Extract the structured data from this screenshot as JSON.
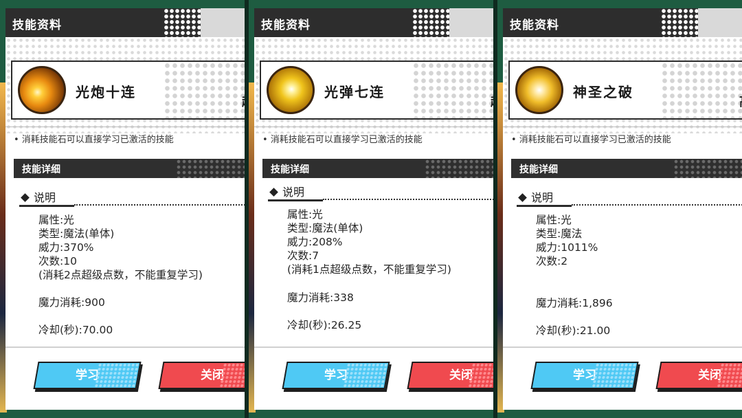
{
  "panels": [
    {
      "header_title": "技能资料",
      "skill_name": "光炮十连",
      "side_char": "超",
      "note": "• 消耗技能石可以直接学习已激活的技能",
      "section_title": "技能详细",
      "desc_heading": "说明",
      "lines": [
        "属性:光",
        "类型:魔法(单体)",
        "威力:370%",
        "次数:10",
        "(消耗2点超级点数，不能重复学习)"
      ],
      "mana": "魔力消耗:900",
      "cooldown": "冷却(秒):70.00",
      "learn_label": "学习",
      "close_label": "关闭"
    },
    {
      "header_title": "技能资料",
      "skill_name": "光弹七连",
      "side_char": "超",
      "note": "• 消耗技能石可以直接学习已激活的技能",
      "section_title": "技能详细",
      "desc_heading": "说明",
      "lines": [
        "属性:光",
        "类型:魔法(单体)",
        "威力:208%",
        "次数:7",
        "(消耗1点超级点数，不能重复学习)"
      ],
      "mana": "魔力消耗:338",
      "cooldown": "冷却(秒):26.25",
      "learn_label": "学习",
      "close_label": "关闭"
    },
    {
      "header_title": "技能资料",
      "skill_name": "神圣之破",
      "side_char": "高",
      "note": "• 消耗技能石可以直接学习已激活的技能",
      "section_title": "技能详细",
      "desc_heading": "说明",
      "lines": [
        "属性:光",
        "类型:魔法",
        "威力:1011%",
        "次数:2",
        ""
      ],
      "mana": "魔力消耗:1,896",
      "cooldown": "冷却(秒):21.00",
      "learn_label": "学习",
      "close_label": "关闭"
    }
  ],
  "colors": {
    "learn_button": "#4fc9f4",
    "close_button": "#f04a4f",
    "header_bg": "#2d2d2d",
    "frame_green": "#1f6a4a"
  },
  "icons": [
    "light-cannon-skill-icon",
    "light-bullet-skill-icon",
    "holy-break-skill-icon"
  ]
}
